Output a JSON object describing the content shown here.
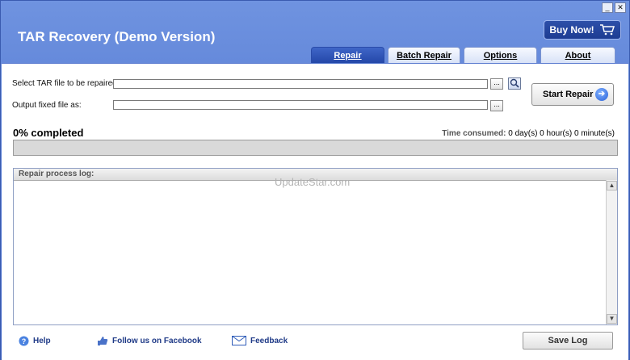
{
  "app": {
    "title": "TAR Recovery (Demo Version)",
    "buy_now": "Buy Now!"
  },
  "window_controls": {
    "minimize": "_",
    "close": "✕"
  },
  "tabs": [
    {
      "label": "Repair",
      "active": true
    },
    {
      "label": "Batch Repair",
      "active": false
    },
    {
      "label": "Options",
      "active": false
    },
    {
      "label": "About",
      "active": false
    }
  ],
  "repair": {
    "select_label": "Select TAR file to be repaired:",
    "select_value": "",
    "output_label": "Output fixed file as:",
    "output_value": "",
    "browse": "...",
    "start_repair": "Start Repair"
  },
  "progress": {
    "completed_text": "0% completed",
    "percent": 0,
    "time_label": "Time consumed:",
    "time_value": "0 day(s) 0 hour(s) 0 minute(s)"
  },
  "log": {
    "header": "Repair process log:",
    "content": ""
  },
  "watermark": "UpdateStar.com",
  "footer": {
    "help": "Help",
    "facebook": "Follow us on Facebook",
    "feedback": "Feedback",
    "save_log": "Save Log"
  },
  "colors": {
    "frame": "#4f74cf",
    "accent": "#2447a8",
    "link": "#1f3a87"
  }
}
